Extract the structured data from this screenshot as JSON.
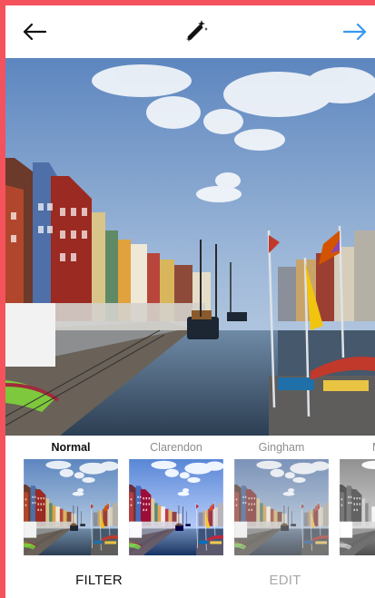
{
  "toolbar": {
    "back_icon": "arrow-left-icon",
    "adjust_icon": "magic-wand-icon",
    "next_icon": "arrow-right-icon",
    "next_color": "#3897f0"
  },
  "filters": [
    {
      "name": "Normal",
      "selected": true,
      "tone": "normal"
    },
    {
      "name": "Clarendon",
      "selected": false,
      "tone": "clarendon"
    },
    {
      "name": "Gingham",
      "selected": false,
      "tone": "gingham"
    },
    {
      "name": "Moon",
      "selected": false,
      "tone": "mono"
    }
  ],
  "tabs": {
    "filter_label": "FILTER",
    "edit_label": "EDIT",
    "active": "FILTER"
  },
  "colors": {
    "frame": "#f4525c",
    "selected_text": "#111111",
    "inactive_text": "#8e8e8e"
  }
}
